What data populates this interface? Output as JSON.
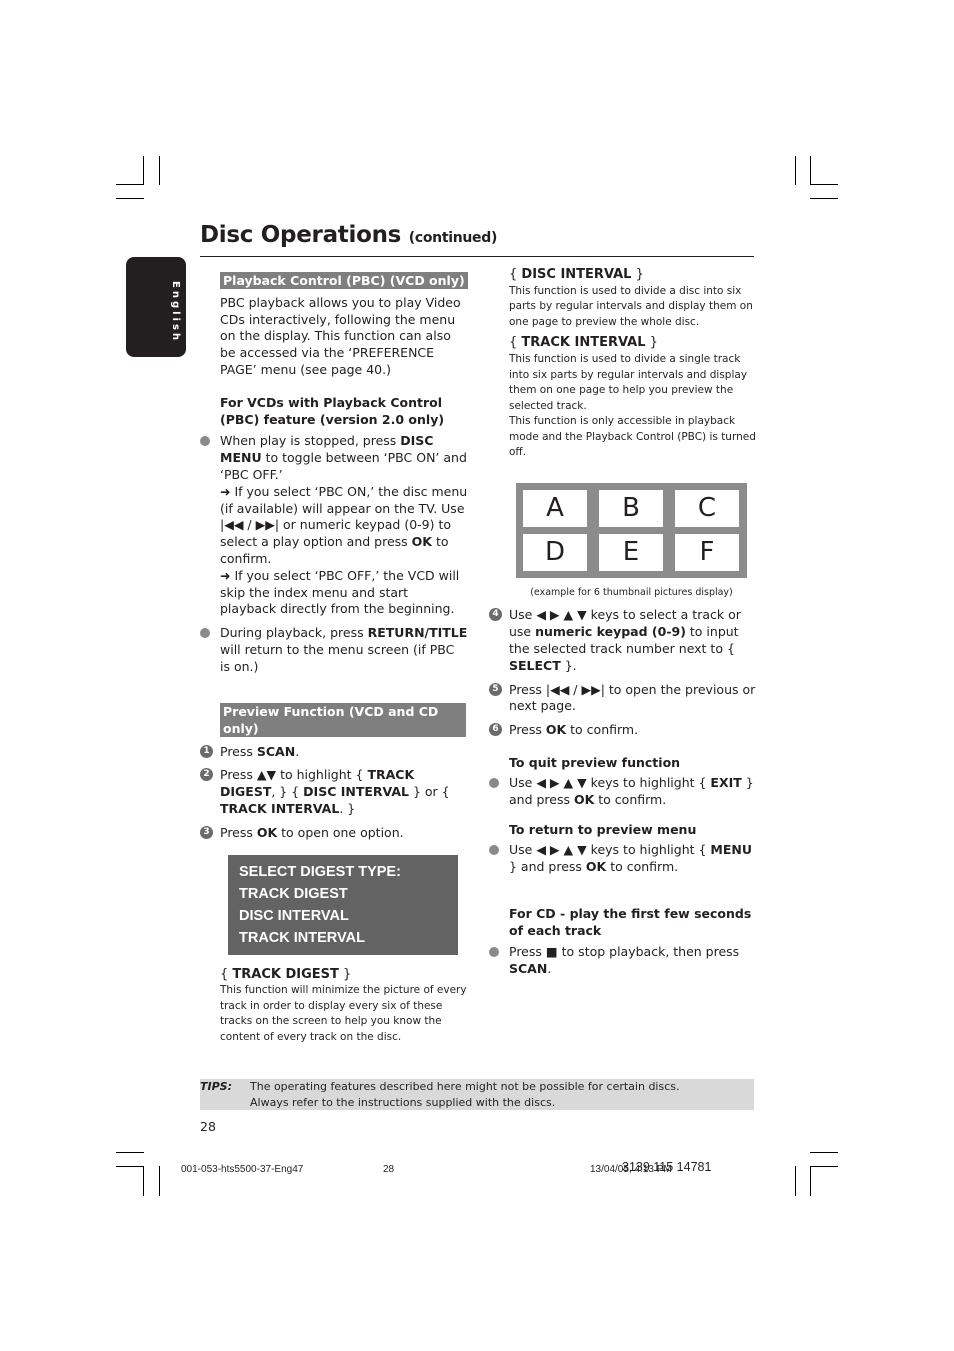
{
  "header": {
    "title": "Disc Operations",
    "subtitle": "(continued)",
    "language_tab": "English"
  },
  "left": {
    "pbc_section": {
      "heading": "Playback Control (PBC) (VCD only)",
      "intro": "PBC playback allows you to play Video CDs interactively, following the menu on the display. This function can also be accessed via the ‘PREFERENCE PAGE’ menu (see page 40.)",
      "subheading": "For VCDs with Playback Control (PBC) feature (version 2.0 only)",
      "bullet1": {
        "pre": "When play is stopped, press ",
        "key": "DISC MENU",
        "post": " to toggle between ‘PBC ON’ and ‘PBC OFF.’",
        "arrow1_pre": "If you select ‘PBC ON,’ the disc menu (if available) will appear on the TV. Use ",
        "arrow1_keys": "|◀◀ / ▶▶|",
        "arrow1_mid": " or numeric keypad (0-9) to select a play option and press ",
        "arrow1_key": "OK",
        "arrow1_post": " to confirm.",
        "arrow2": "If you select ‘PBC OFF,’ the VCD will skip the index menu and start playback directly from the beginning."
      },
      "bullet2": {
        "pre": "During playback, press ",
        "key": "RETURN/TITLE",
        "post": " will return to the menu screen (if PBC is on.)"
      }
    },
    "preview_section": {
      "heading": "Preview Function (VCD and CD only)",
      "steps": [
        {
          "num": "1",
          "pre": "Press ",
          "key": "SCAN",
          "post": "."
        },
        {
          "num": "2",
          "pre": "Press ▲▼ to highlight { ",
          "key": "TRACK DIGEST",
          "mid": ", } { ",
          "key2": "DISC INTERVAL",
          "mid2": " } or { ",
          "key3": "TRACK INTERVAL",
          "post": ". }"
        },
        {
          "num": "3",
          "pre": "Press ",
          "key": "OK",
          "post": " to open one option."
        }
      ],
      "menu_box": [
        "SELECT DIGEST TYPE:",
        "TRACK DIGEST",
        "DISC INTERVAL",
        "TRACK INTERVAL"
      ],
      "track_digest": {
        "label": "TRACK DIGEST",
        "text": "This function will minimize the picture of every track in order to display every six of these tracks on the screen to help you know the content of every track on the disc."
      }
    }
  },
  "right": {
    "disc_interval": {
      "label": "DISC INTERVAL",
      "text": "This function is used to divide a disc into six parts by regular intervals and display them on one page to preview the whole disc."
    },
    "track_interval": {
      "label": "TRACK INTERVAL",
      "text": "This function is used to divide a single track into six parts by regular intervals and display them on one page to help you preview the selected track.",
      "note": "This function is only accessible in playback mode and the Playback Control (PBC) is turned off."
    },
    "thumbnails": [
      "A",
      "B",
      "C",
      "D",
      "E",
      "F"
    ],
    "thumb_caption": "(example for 6 thumbnail pictures display)",
    "steps": [
      {
        "num": "4",
        "pre": "Use ◀ ▶ ▲ ▼ keys to select a track or use ",
        "key": "numeric keypad (0-9)",
        "mid": " to input the selected track number next to { ",
        "key2": "SELECT",
        "post": " }."
      },
      {
        "num": "5",
        "pre": "Press |◀◀ / ▶▶| to open the previous or next page."
      },
      {
        "num": "6",
        "pre": "Press ",
        "key": "OK",
        "post": " to confirm."
      }
    ],
    "quit": {
      "heading": "To quit preview function",
      "pre": "Use ◀ ▶ ▲ ▼ keys to highlight { ",
      "key": "EXIT",
      "mid": " } and press ",
      "key2": "OK",
      "post": " to confirm."
    },
    "return": {
      "heading": "To return to preview menu",
      "pre": "Use ◀ ▶ ▲ ▼ keys to highlight { ",
      "key": "MENU",
      "mid": " } and press ",
      "key2": "OK",
      "post": " to confirm."
    },
    "cd": {
      "heading": "For CD - play the first few seconds of each track",
      "pre": "Press ",
      "stop": "■",
      "mid": " to stop playback, then press ",
      "key": "SCAN",
      "post": "."
    }
  },
  "tips": {
    "label": "TIPS:",
    "line1": "The operating features described here might not be possible for certain discs.",
    "line2": "Always refer to the instructions supplied with the discs."
  },
  "page_number": "28",
  "footer": {
    "file": "001-053-hts5500-37-Eng47",
    "page": "28",
    "date": "13/04/05, 4:13 PM",
    "code": "3139 115 14781"
  }
}
